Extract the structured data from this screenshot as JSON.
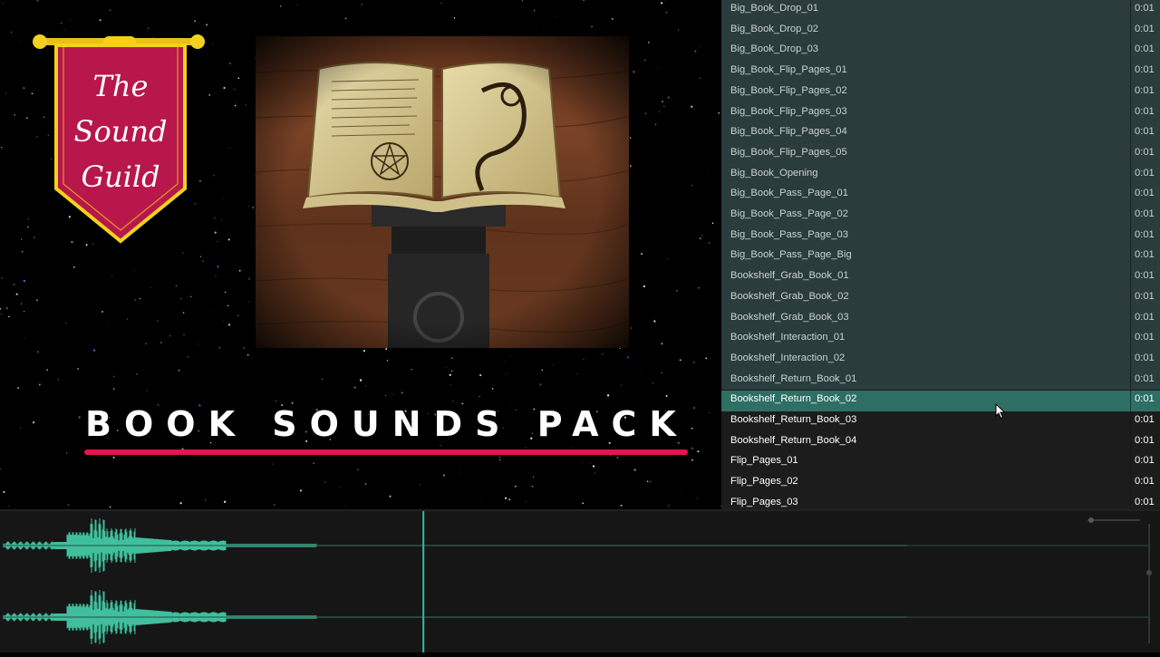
{
  "promo": {
    "banner_lines": [
      "The",
      "Sound",
      "Guild"
    ],
    "title": "BOOK SOUNDS PACK",
    "colors": {
      "accent": "#e3164f",
      "banner": "#b8174b",
      "gold": "#f2d21e"
    }
  },
  "files": [
    {
      "name": "Big_Book_Drop_01",
      "duration": "0:01"
    },
    {
      "name": "Big_Book_Drop_02",
      "duration": "0:01"
    },
    {
      "name": "Big_Book_Drop_03",
      "duration": "0:01"
    },
    {
      "name": "Big_Book_Flip_Pages_01",
      "duration": "0:01"
    },
    {
      "name": "Big_Book_Flip_Pages_02",
      "duration": "0:01"
    },
    {
      "name": "Big_Book_Flip_Pages_03",
      "duration": "0:01"
    },
    {
      "name": "Big_Book_Flip_Pages_04",
      "duration": "0:01"
    },
    {
      "name": "Big_Book_Flip_Pages_05",
      "duration": "0:01"
    },
    {
      "name": "Big_Book_Opening",
      "duration": "0:01"
    },
    {
      "name": "Big_Book_Pass_Page_01",
      "duration": "0:01"
    },
    {
      "name": "Big_Book_Pass_Page_02",
      "duration": "0:01"
    },
    {
      "name": "Big_Book_Pass_Page_03",
      "duration": "0:01"
    },
    {
      "name": "Big_Book_Pass_Page_Big",
      "duration": "0:01"
    },
    {
      "name": "Bookshelf_Grab_Book_01",
      "duration": "0:01"
    },
    {
      "name": "Bookshelf_Grab_Book_02",
      "duration": "0:01"
    },
    {
      "name": "Bookshelf_Grab_Book_03",
      "duration": "0:01"
    },
    {
      "name": "Bookshelf_Interaction_01",
      "duration": "0:01"
    },
    {
      "name": "Bookshelf_Interaction_02",
      "duration": "0:01"
    },
    {
      "name": "Bookshelf_Return_Book_01",
      "duration": "0:01"
    },
    {
      "name": "Bookshelf_Return_Book_02",
      "duration": "0:01"
    },
    {
      "name": "Bookshelf_Return_Book_03",
      "duration": "0:01"
    },
    {
      "name": "Bookshelf_Return_Book_04",
      "duration": "0:01"
    },
    {
      "name": "Flip_Pages_01",
      "duration": "0:01"
    },
    {
      "name": "Flip_Pages_02",
      "duration": "0:01"
    },
    {
      "name": "Flip_Pages_03",
      "duration": "0:01"
    }
  ],
  "selected_index": 19,
  "waveform": {
    "color": "#3fbf9c",
    "playhead_color": "#2fc0a0",
    "playhead_fraction": 0.365
  }
}
